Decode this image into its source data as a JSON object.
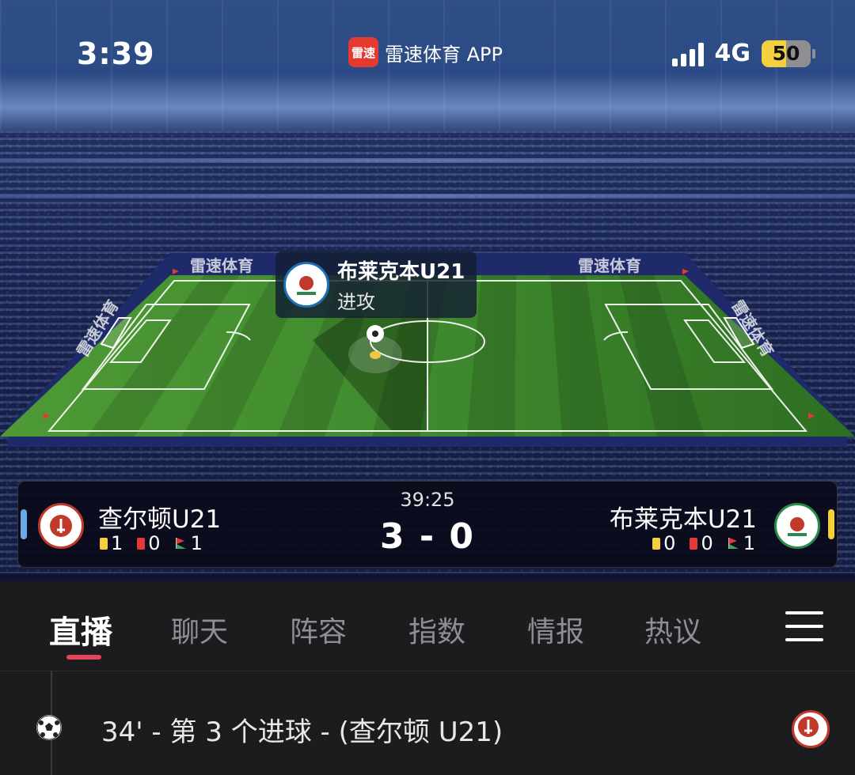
{
  "status_bar": {
    "time": "3:39",
    "app_logo_text": "雷速",
    "app_name": "雷速体育 APP",
    "network": "4G",
    "battery": "50",
    "battery_level": 0.5
  },
  "pitch": {
    "hoarding_text": "雷速体育",
    "attack_team": "布莱克本U21",
    "attack_status": "进攻"
  },
  "match": {
    "time": "39:25",
    "score": "3 - 0",
    "home": {
      "name": "查尔顿U21",
      "yellow_cards": "1",
      "red_cards": "0",
      "corners": "1",
      "indicator_color": "#6aa8e8"
    },
    "away": {
      "name": "布莱克本U21",
      "yellow_cards": "0",
      "red_cards": "0",
      "corners": "1",
      "indicator_color": "#f4d03f"
    }
  },
  "tabs": [
    {
      "label": "直播",
      "active": true
    },
    {
      "label": "聊天"
    },
    {
      "label": "阵容"
    },
    {
      "label": "指数"
    },
    {
      "label": "情报"
    },
    {
      "label": "热议"
    }
  ],
  "events": [
    {
      "icon": "soccer-ball-icon",
      "text": "34' - 第 3 个进球 - (查尔顿 U21)"
    }
  ],
  "colors": {
    "accent": "#e0485a",
    "pitch_green": "#3f8a2e"
  }
}
